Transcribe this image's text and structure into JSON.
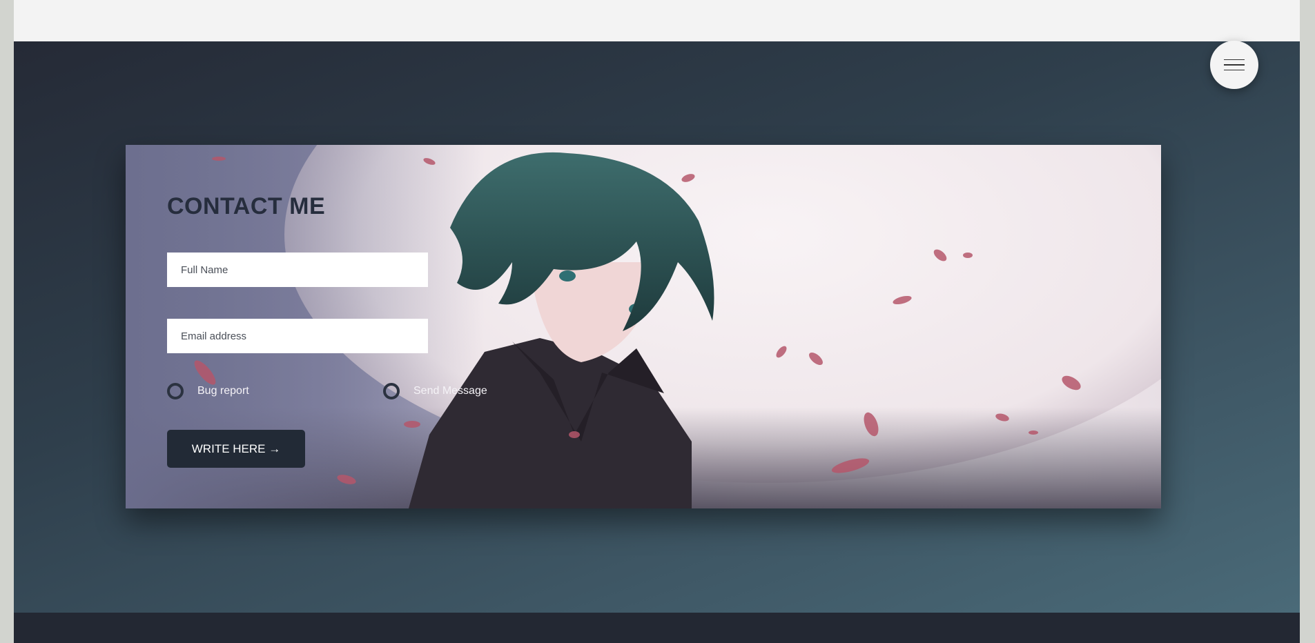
{
  "menu": {
    "icon": "hamburger-menu-icon"
  },
  "contact": {
    "title": "CONTACT ME",
    "name_placeholder": "Full Name",
    "email_placeholder": "Email address",
    "options": [
      "Bug report",
      "Send Message"
    ],
    "submit_label": "WRITE HERE →"
  },
  "colors": {
    "hero_dark": "#252a36",
    "hero_light": "#4a6a78",
    "button_bg": "#222a36",
    "title_color": "#262d3d",
    "footer": "#232833"
  }
}
